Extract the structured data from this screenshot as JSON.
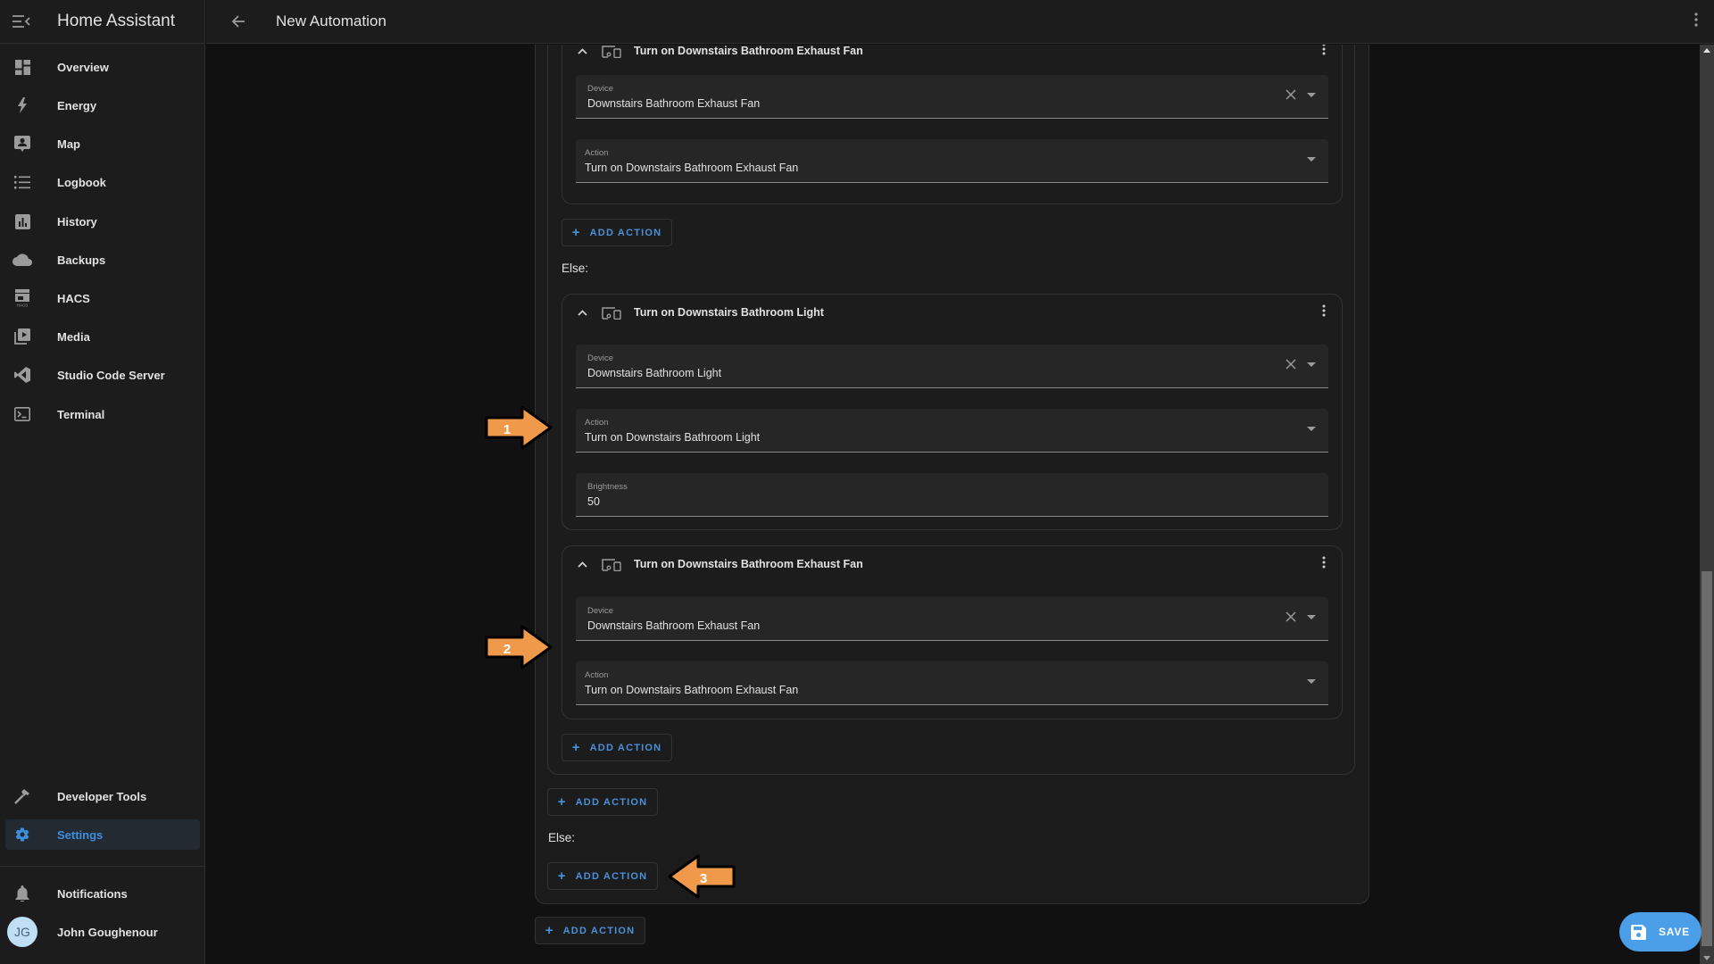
{
  "app": {
    "title": "Home Assistant"
  },
  "header": {
    "title": "New Automation"
  },
  "sidebar": {
    "items": [
      {
        "label": "Overview",
        "icon": "view-dashboard-icon"
      },
      {
        "label": "Energy",
        "icon": "lightning-bolt-icon"
      },
      {
        "label": "Map",
        "icon": "map-account-icon"
      },
      {
        "label": "Logbook",
        "icon": "format-list-bulleted-icon"
      },
      {
        "label": "History",
        "icon": "chart-box-icon"
      },
      {
        "label": "Backups",
        "icon": "cloud-icon"
      },
      {
        "label": "HACS",
        "icon": "hacs-store-icon"
      },
      {
        "label": "Media",
        "icon": "play-box-multiple-icon"
      },
      {
        "label": "Studio Code Server",
        "icon": "vscode-icon"
      },
      {
        "label": "Terminal",
        "icon": "console-icon"
      }
    ],
    "bottom_items": [
      {
        "label": "Developer Tools",
        "icon": "hammer-icon"
      },
      {
        "label": "Settings",
        "icon": "cog-icon",
        "active": true
      }
    ],
    "notifications": {
      "label": "Notifications"
    },
    "user": {
      "name": "John Goughenour",
      "initials": "JG"
    }
  },
  "editor": {
    "cards": [
      {
        "title": "Turn on Downstairs Bathroom Exhaust Fan",
        "fields": [
          {
            "label": "Device",
            "value": "Downstairs Bathroom Exhaust Fan",
            "clearable": true
          },
          {
            "label": "Action",
            "value": "Turn on Downstairs Bathroom Exhaust Fan"
          }
        ]
      },
      {
        "title": "Turn on Downstairs Bathroom Light",
        "fields": [
          {
            "label": "Device",
            "value": "Downstairs Bathroom Light",
            "clearable": true
          },
          {
            "label": "Action",
            "value": "Turn on Downstairs Bathroom Light"
          },
          {
            "label": "Brightness",
            "value": "50"
          }
        ]
      },
      {
        "title": "Turn on Downstairs Bathroom Exhaust Fan",
        "fields": [
          {
            "label": "Device",
            "value": "Downstairs Bathroom Exhaust Fan",
            "clearable": true
          },
          {
            "label": "Action",
            "value": "Turn on Downstairs Bathroom Exhaust Fan"
          }
        ]
      }
    ],
    "add_action_label": "ADD ACTION",
    "else_label": "Else:"
  },
  "callouts": [
    "1",
    "2",
    "3"
  ],
  "save": {
    "label": "SAVE"
  },
  "colors": {
    "accent": "#4a90d9",
    "fab": "#4a9fe8",
    "callout": "#f0994a"
  }
}
